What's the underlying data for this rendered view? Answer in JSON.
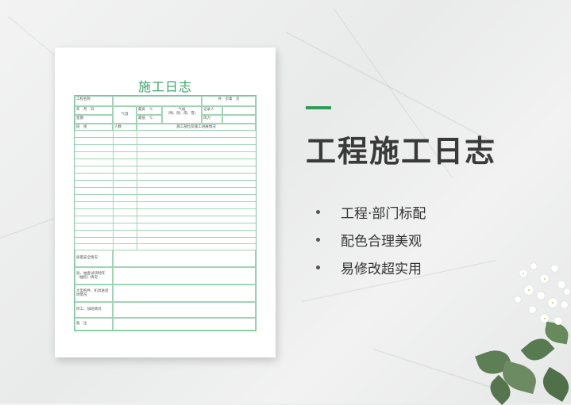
{
  "heading": "工程施工日志",
  "bullets": [
    "工程·部门标配",
    "配色合理美观",
    "易修改超实用"
  ],
  "colors": {
    "accent": "#2e9b5a",
    "form_title": "#3aa36b",
    "form_lines": "#9fd5b5",
    "heading_text": "#3a3a3a"
  },
  "form": {
    "title": "施工日志",
    "project_name": "工程名称",
    "page_info": "共　页第　页",
    "date": "年　月　日",
    "weekday": "星期",
    "weather_label": "气温",
    "high_temp": "最高　℃",
    "low_temp": "最低　℃",
    "weather_type": "气候\n（晴、阴、雨、雪）",
    "recorder": "记录人",
    "wind": "风力",
    "team": "班　组",
    "headcount": "人数",
    "progress": "施工部位及施工进展情况",
    "quality": "质量安全情况",
    "inspection": "验、抽查试块制作（抽检）情况",
    "equipment": "大型构件、机具进退场情况",
    "suspension": "停工、加班情况",
    "remarks": "备　注"
  }
}
